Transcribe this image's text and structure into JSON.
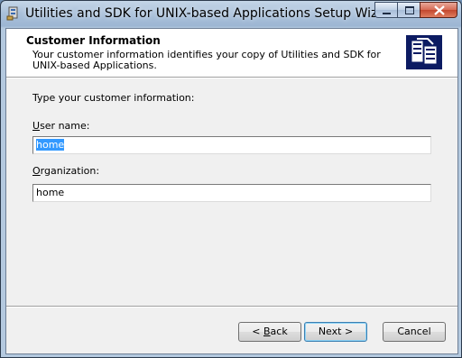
{
  "window": {
    "title": "Utilities and SDK for UNIX-based Applications Setup Wizard"
  },
  "header": {
    "title": "Customer Information",
    "description": "Your customer information identifies your copy of Utilities and SDK for UNIX-based Applications."
  },
  "form": {
    "prompt": "Type your customer information:",
    "user_name": {
      "label_mnemonic": "U",
      "label_rest": "ser name:",
      "value": "home"
    },
    "organization": {
      "label_mnemonic": "O",
      "label_rest": "rganization:",
      "value": "home"
    }
  },
  "buttons": {
    "back": "< Back",
    "back_prefix": "< ",
    "back_mnemonic": "B",
    "back_rest": "ack",
    "next": "Next >",
    "cancel": "Cancel"
  },
  "icons": {
    "app": "setup-package-icon",
    "logo": "server-package-icon",
    "minimize": "minimize-icon",
    "maximize": "maximize-icon",
    "close": "close-icon"
  },
  "colors": {
    "logo_bg": "#0c1b62",
    "selection": "#3399ff",
    "close_button": "#c2472d"
  }
}
